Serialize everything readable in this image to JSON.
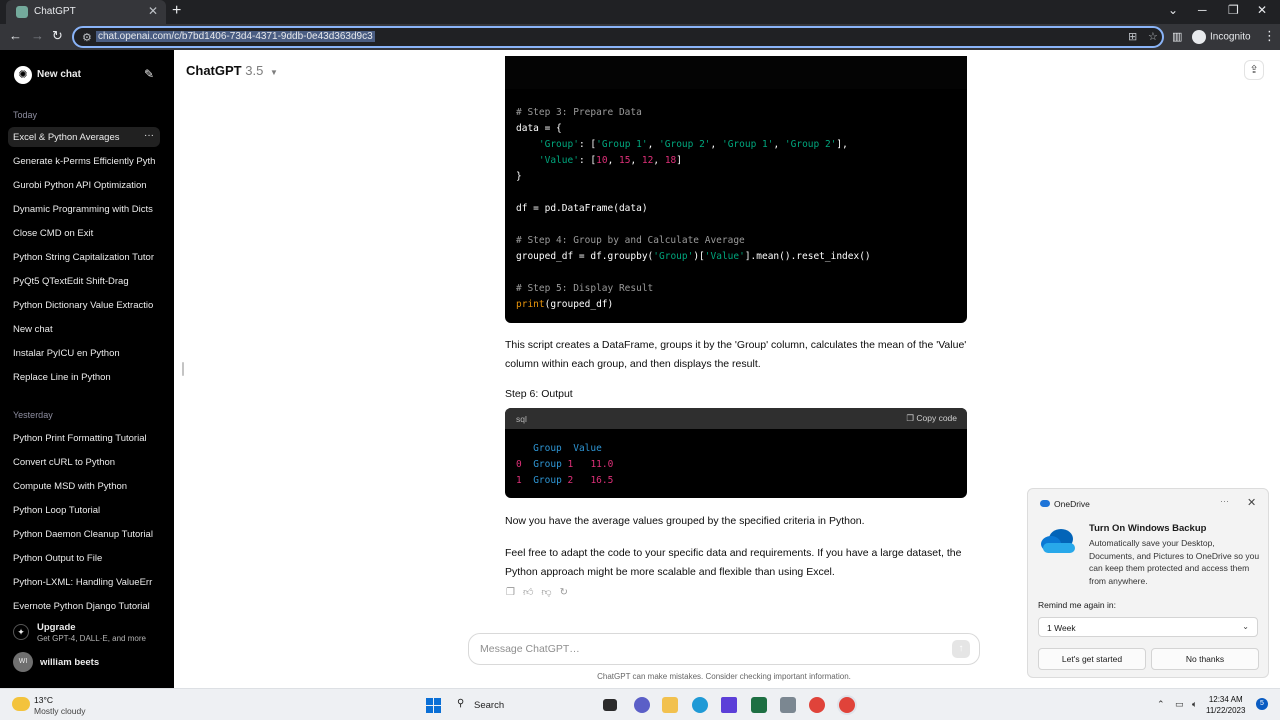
{
  "browser": {
    "tab_title": "ChatGPT",
    "url": "chat.openai.com/c/b7bd1406-73d4-4371-9ddb-0e43d363d9c3",
    "profile_label": "Incognito"
  },
  "sidebar": {
    "new_chat_label": "New chat",
    "today_label": "Today",
    "today_items": [
      {
        "label": "Excel & Python Averages"
      },
      {
        "label": "Generate k-Perms Efficiently Pyth"
      },
      {
        "label": "Gurobi Python API Optimization"
      },
      {
        "label": "Dynamic Programming with Dicts"
      },
      {
        "label": "Close CMD on Exit"
      },
      {
        "label": "Python String Capitalization Tutor"
      },
      {
        "label": "PyQt5 QTextEdit Shift-Drag"
      },
      {
        "label": "Python Dictionary Value Extractio"
      },
      {
        "label": "New chat"
      },
      {
        "label": "Instalar PyICU en Python"
      },
      {
        "label": "Replace Line in Python"
      }
    ],
    "yesterday_label": "Yesterday",
    "yesterday_items": [
      {
        "label": "Python Print Formatting Tutorial"
      },
      {
        "label": "Convert cURL to Python"
      },
      {
        "label": "Compute MSD with Python"
      },
      {
        "label": "Python Loop Tutorial"
      },
      {
        "label": "Python Daemon Cleanup Tutorial"
      },
      {
        "label": "Python Output to File"
      },
      {
        "label": "Python-LXML: Handling ValueErr"
      },
      {
        "label": "Evernote Python Django Tutorial"
      }
    ],
    "upgrade_title": "Upgrade",
    "upgrade_subtitle": "Get GPT-4, DALL·E, and more",
    "user_initials": "WI",
    "user_name": "william beets"
  },
  "header": {
    "model_name": "ChatGPT",
    "model_version": "3.5"
  },
  "code_block_1": {
    "lines": [
      {
        "segments": [
          {
            "t": "# Step 3: Prepare Data",
            "c": "cm"
          }
        ]
      },
      {
        "segments": [
          {
            "t": "data = {",
            "c": ""
          }
        ]
      },
      {
        "segments": [
          {
            "t": "    ",
            "c": ""
          },
          {
            "t": "'Group'",
            "c": "str"
          },
          {
            "t": ": [",
            "c": ""
          },
          {
            "t": "'Group 1'",
            "c": "str"
          },
          {
            "t": ", ",
            "c": ""
          },
          {
            "t": "'Group 2'",
            "c": "str"
          },
          {
            "t": ", ",
            "c": ""
          },
          {
            "t": "'Group 1'",
            "c": "str"
          },
          {
            "t": ", ",
            "c": ""
          },
          {
            "t": "'Group 2'",
            "c": "str"
          },
          {
            "t": "],",
            "c": ""
          }
        ]
      },
      {
        "segments": [
          {
            "t": "    ",
            "c": ""
          },
          {
            "t": "'Value'",
            "c": "str"
          },
          {
            "t": ": [",
            "c": ""
          },
          {
            "t": "10",
            "c": "num"
          },
          {
            "t": ", ",
            "c": ""
          },
          {
            "t": "15",
            "c": "num"
          },
          {
            "t": ", ",
            "c": ""
          },
          {
            "t": "12",
            "c": "num"
          },
          {
            "t": ", ",
            "c": ""
          },
          {
            "t": "18",
            "c": "num"
          },
          {
            "t": "]",
            "c": ""
          }
        ]
      },
      {
        "segments": [
          {
            "t": "}",
            "c": ""
          }
        ]
      },
      {
        "segments": [
          {
            "t": "",
            "c": ""
          }
        ]
      },
      {
        "segments": [
          {
            "t": "df = pd.DataFrame(data)",
            "c": ""
          }
        ]
      },
      {
        "segments": [
          {
            "t": "",
            "c": ""
          }
        ]
      },
      {
        "segments": [
          {
            "t": "# Step 4: Group by and Calculate Average",
            "c": "cm"
          }
        ]
      },
      {
        "segments": [
          {
            "t": "grouped_df = df.groupby(",
            "c": ""
          },
          {
            "t": "'Group'",
            "c": "str"
          },
          {
            "t": ")[",
            "c": ""
          },
          {
            "t": "'Value'",
            "c": "str"
          },
          {
            "t": "].mean().reset_index()",
            "c": ""
          }
        ]
      },
      {
        "segments": [
          {
            "t": "",
            "c": ""
          }
        ]
      },
      {
        "segments": [
          {
            "t": "# Step 5: Display Result",
            "c": "cm"
          }
        ]
      },
      {
        "segments": [
          {
            "t": "print",
            "c": "fn"
          },
          {
            "t": "(grouped_df)",
            "c": ""
          }
        ]
      }
    ]
  },
  "explanation": "This script creates a DataFrame, groups it by the 'Group' column, calculates the mean of the 'Value' column within each group, and then displays the result.",
  "step6_heading": "Step 6: Output",
  "code_block_2": {
    "language": "sql",
    "copy_label": "Copy code",
    "lines": [
      {
        "segments": [
          {
            "t": "   ",
            "c": ""
          },
          {
            "t": "Group",
            "c": "blue"
          },
          {
            "t": "  ",
            "c": ""
          },
          {
            "t": "Value",
            "c": "blue"
          }
        ]
      },
      {
        "segments": [
          {
            "t": "0",
            "c": "num"
          },
          {
            "t": "  ",
            "c": ""
          },
          {
            "t": "Group",
            "c": "blue"
          },
          {
            "t": " ",
            "c": ""
          },
          {
            "t": "1",
            "c": "num"
          },
          {
            "t": "   ",
            "c": ""
          },
          {
            "t": "11.0",
            "c": "num"
          }
        ]
      },
      {
        "segments": [
          {
            "t": "1",
            "c": "num"
          },
          {
            "t": "  ",
            "c": ""
          },
          {
            "t": "Group",
            "c": "blue"
          },
          {
            "t": " ",
            "c": ""
          },
          {
            "t": "2",
            "c": "num"
          },
          {
            "t": "   ",
            "c": ""
          },
          {
            "t": "16.5",
            "c": "num"
          }
        ]
      }
    ]
  },
  "summary": "Now you have the average values grouped by the specified criteria in Python.",
  "closing": "Feel free to adapt the code to your specific data and requirements. If you have a large dataset, the Python approach might be more scalable and flexible than using Excel.",
  "composer": {
    "placeholder": "Message ChatGPT…",
    "disclaimer": "ChatGPT can make mistakes. Consider checking important information."
  },
  "onedrive": {
    "app_name": "OneDrive",
    "title": "Turn On Windows Backup",
    "body": "Automatically save your Desktop, Documents, and Pictures to OneDrive so you can keep them protected and access them from anywhere.",
    "remind_label": "Remind me again in:",
    "remind_value": "1 Week",
    "primary_button": "Let's get started",
    "secondary_button": "No thanks"
  },
  "taskbar": {
    "temperature": "13°C",
    "weather": "Mostly cloudy",
    "search_label": "Search",
    "time": "12:34 AM",
    "date": "11/22/2023",
    "notification_count": "5"
  }
}
